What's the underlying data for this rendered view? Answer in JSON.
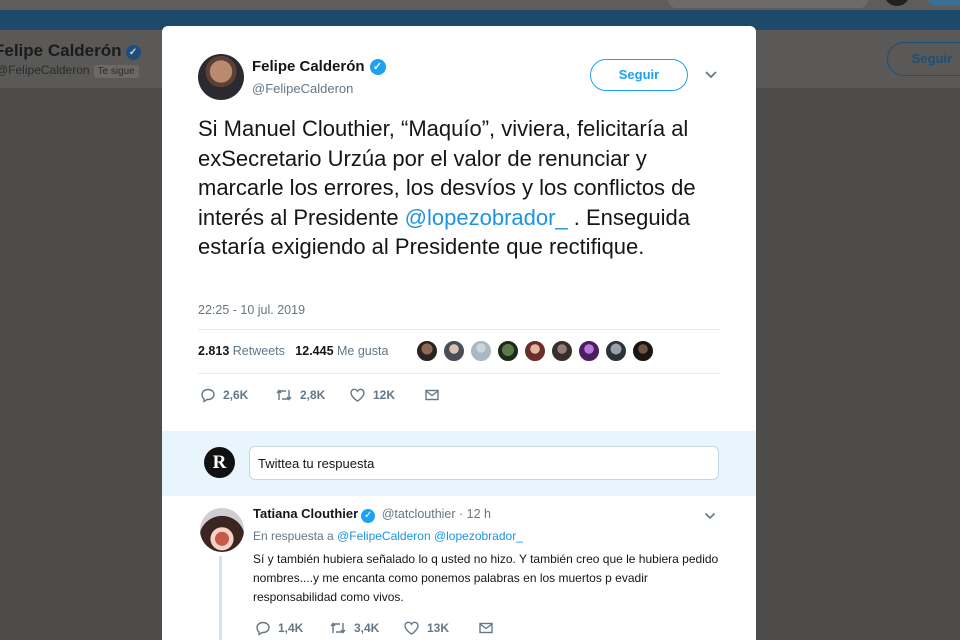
{
  "background": {
    "profile_name": "Felipe Calderón",
    "profile_handle": "@FelipeCalderon",
    "follows_you": "Te sigue",
    "follow_label": "Seguir"
  },
  "tweet": {
    "author_name": "Felipe Calderón",
    "author_handle": "@FelipeCalderon",
    "follow_label": "Seguir",
    "text_part1": "Si Manuel Clouthier, “Maquío”, viviera, felicitaría al exSecretario Urzúa por el valor de renunciar y marcarle los errores, los desvíos y los conflictos de interés al Presidente ",
    "mention": "@lopezobrador_",
    "text_part2": " . Enseguida estaría exigiendo al Presidente que rectifique.",
    "timestamp": "22:25 - 10 jul. 2019",
    "retweets_count": "2.813",
    "retweets_label": "Retweets",
    "likes_count": "12.445",
    "likes_label": "Me gusta",
    "replies": "2,6K",
    "retweets_short": "2,8K",
    "likes_short": "12K"
  },
  "composer": {
    "placeholder": "Twittea tu respuesta"
  },
  "reply": {
    "author_name": "Tatiana Clouthier",
    "author_handle": "@tatclouthier",
    "time": "12 h",
    "in_reply_prefix": "En respuesta a",
    "in_reply_mentions": "@FelipeCalderon @lopezobrador_",
    "text": "Sí y también hubiera señalado lo q usted no hizo. Y también creo que le hubiera pedido nombres....y me encanta como ponemos palabras en los muertos p evadir responsabilidad como vivos.",
    "replies": "1,4K",
    "retweets": "3,4K",
    "likes": "13K"
  },
  "colors": {
    "accent": "#1da1f2",
    "mention": "#1b95e0",
    "muted": "#657786",
    "overlay": "#4e4c4b"
  },
  "icons": [
    "reply-icon",
    "retweet-icon",
    "like-icon",
    "direct-message-icon",
    "verified-icon",
    "chevron-down-icon"
  ]
}
